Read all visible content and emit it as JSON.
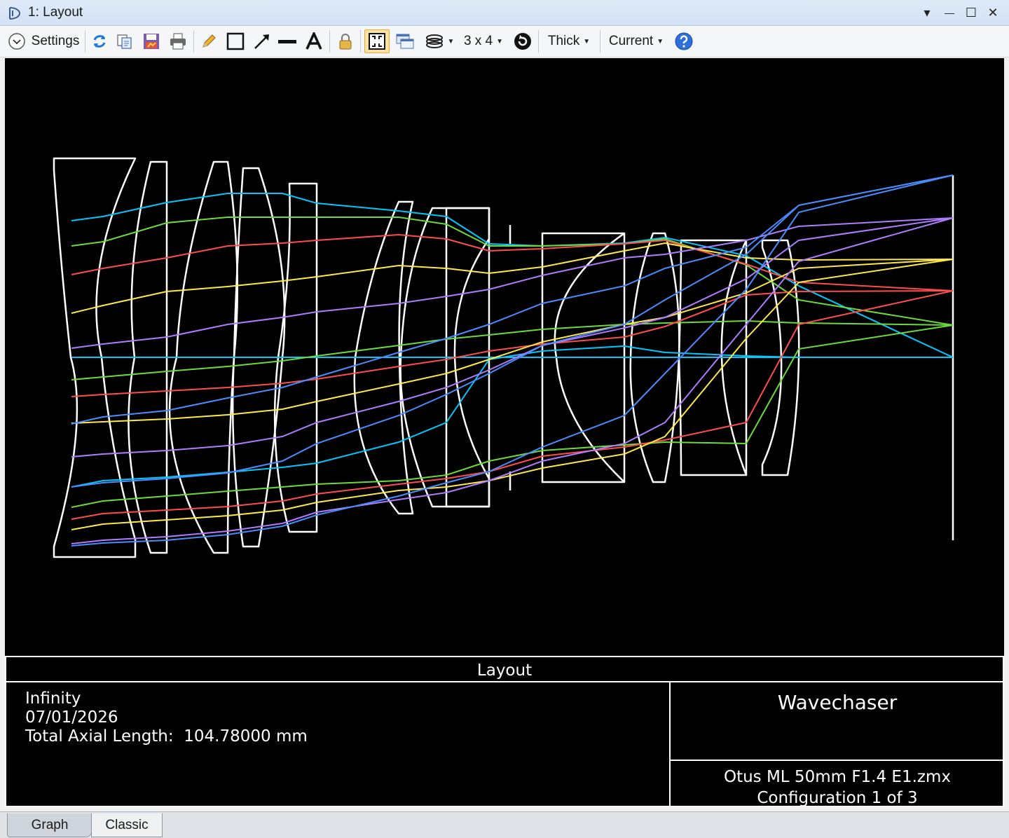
{
  "window": {
    "title": "1: Layout",
    "controls": {
      "menu": "▾",
      "minimize": "—",
      "maximize": "☐",
      "close": "✕"
    }
  },
  "toolbar": {
    "settings_label": "Settings",
    "grid_label": "3 x 4",
    "line_label": "Thick",
    "config_label": "Current",
    "icons": [
      "refresh-icon",
      "copy-icon",
      "save-icon",
      "print-icon",
      "pencil-icon",
      "rectangle-icon",
      "arrow-icon",
      "line-icon",
      "text-icon",
      "lock-icon",
      "zoom-window-icon",
      "windows-icon",
      "layers-icon",
      "reset-icon",
      "help-icon"
    ]
  },
  "plot": {
    "background": "#000000",
    "element_color": "#ffffff",
    "ray_colors": [
      "#00c8ff",
      "#6cd93c",
      "#ff4d4d",
      "#ffe84a",
      "#b07cff",
      "#4a8cff"
    ]
  },
  "info": {
    "caption": "Layout",
    "lines": [
      "Infinity",
      "07/01/2026",
      "Total Axial Length:  104.78000 mm"
    ],
    "company": "Wavechaser",
    "file_lines": [
      "Otus ML 50mm F1.4 E1.zmx",
      "Configuration 1 of 3"
    ]
  },
  "tabs": [
    "Graph",
    "Classic"
  ]
}
